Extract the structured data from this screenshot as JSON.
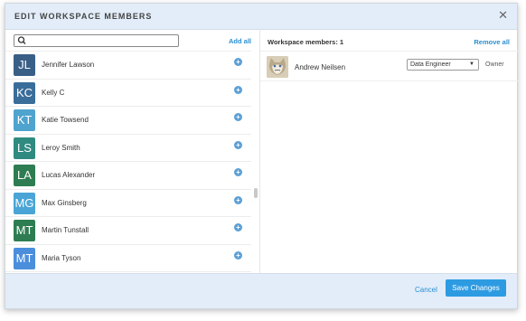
{
  "dialog": {
    "title": "EDIT WORKSPACE MEMBERS",
    "close_icon": "close-icon"
  },
  "left_panel": {
    "search": {
      "placeholder": "",
      "value": ""
    },
    "add_all_label": "Add all",
    "users": [
      {
        "initials": "JL",
        "name": "Jennifer Lawson",
        "color": "#3a5f87"
      },
      {
        "initials": "KC",
        "name": "Kelly C",
        "color": "#3a6d9a"
      },
      {
        "initials": "KT",
        "name": "Katie Towsend",
        "color": "#4fa3cf"
      },
      {
        "initials": "LS",
        "name": "Leroy Smith",
        "color": "#2f8a80"
      },
      {
        "initials": "LA",
        "name": "Lucas Alexander",
        "color": "#2e7d52"
      },
      {
        "initials": "MG",
        "name": "Max Ginsberg",
        "color": "#4aa5d6"
      },
      {
        "initials": "MT",
        "name": "Martin Tunstall",
        "color": "#2e7d52"
      },
      {
        "initials": "MT",
        "name": "Maria Tyson",
        "color": "#4b8edc"
      }
    ]
  },
  "right_panel": {
    "title": "Workspace members:  1",
    "remove_all_label": "Remove all",
    "members": [
      {
        "name": "Andrew Neilsen",
        "role": "Data Engineer",
        "status": "Owner"
      }
    ]
  },
  "footer": {
    "cancel_label": "Cancel",
    "save_label": "Save Changes"
  }
}
